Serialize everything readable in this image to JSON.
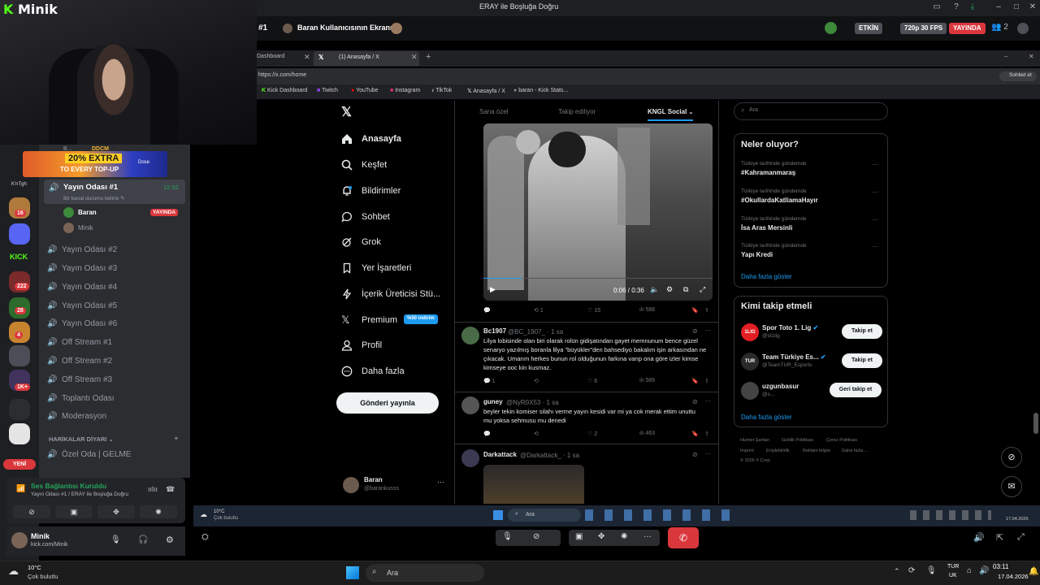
{
  "window": {
    "title": "ERAY ile Boşluğa Doğru"
  },
  "webcam": {
    "brand_k": "K",
    "brand_name": "Minik"
  },
  "promo": {
    "line1": "20% EXTRA",
    "line2": "TO EVERY TOP-UP",
    "logo": "Dose"
  },
  "server_badges": [
    "16",
    "222",
    "28",
    "4",
    "1K+"
  ],
  "server_labels": {
    "kick": "KICK",
    "new": "YENİ",
    "kntg": "K'nTgh"
  },
  "channels": {
    "top_user": "B... ",
    "top_tag": "DDCM",
    "active": {
      "name": "Yayın Odası #1",
      "time": "12:32",
      "status": "Bir kanal durumu belirle"
    },
    "members": [
      {
        "name": "Baran",
        "badge": "YAYINDA"
      },
      {
        "name": "Minik",
        "badge": ""
      }
    ],
    "list": [
      "Yayın Odası #2",
      "Yayın Odası #3",
      "Yayın Odası #4",
      "Yayın Odası #5",
      "Yayın Odası #6",
      "Off Stream #1",
      "Off Stream #2",
      "Off Stream #3",
      "Toplantı Odası",
      "Moderasyon"
    ],
    "category": "HARİKALAR DİYARI",
    "category_item": "Özel Oda | GELME"
  },
  "voice": {
    "status": "Ses Bağlantısı Kuruldu",
    "location": "Yayın Odası #1 / ERAY ile Boşluğa Doğru"
  },
  "user": {
    "name": "Minik",
    "sub": "kick.com/Minik"
  },
  "stream": {
    "channel": "#1",
    "screen_title": "Baran Kullanıcısının Ekranı",
    "pill_live_label": "ETKİN",
    "pill_quality": "720p 30 FPS",
    "pill_live": "YAYINDA",
    "viewers": "2"
  },
  "browser": {
    "tab1": "Dashboard",
    "tab2": "(1) Anasayfa / X",
    "url": "https://x.com/home",
    "chat_btn": "Sohbet et",
    "bookmarks": [
      "Kick Dashboard",
      "Twitch",
      "YouTube",
      "Instagram",
      "TikTok",
      "Anasayfa / X",
      "baran - Kick Stats..."
    ]
  },
  "x_nav": {
    "items": [
      "Anasayfa",
      "Keşfet",
      "Bildirimler",
      "Sohbet",
      "Grok",
      "Yer İşaretleri",
      "İçerik Üreticisi Stü...",
      "Premium",
      "Profil",
      "Daha fazla"
    ],
    "premium_badge": "%50 indirim",
    "post_button": "Gönderi yayınla",
    "account_name": "Baran",
    "account_handle": "@barankusss"
  },
  "feed": {
    "tabs": [
      "Sana özel",
      "Takip ediliyor",
      "KNGL Social"
    ],
    "video_time": "0:06 / 0:36",
    "video_actions": {
      "replies": "",
      "reposts": "1",
      "likes": "15",
      "views": "588"
    },
    "tweets": [
      {
        "name": "Bc1907",
        "handle": "@BC_1907_ · 1 sa",
        "text": "Lilya lobisinde olan biri olarak rolün gidişatından gayet memnunum bence güzel senaryo yazılmış boranla lilya \"büyükler\"den bahsediyo bakalım işin arkasından ne çıkacak. Umarım herkes bunun rol olduğunun farkına varıp ona göre izler kimse kimseye ooc kin kusmaz.",
        "replies": "1",
        "reposts": "",
        "likes": "6",
        "views": "589"
      },
      {
        "name": "guney",
        "handle": "@NyR0X53 · 1 sa",
        "text": "beyler tekin komiser silahı verme yayın kesidi var mi ya cok merak ettim unuttu mu yoksa sehmusu mu denedi",
        "replies": "",
        "reposts": "",
        "likes": "2",
        "views": "463"
      },
      {
        "name": "Darkattack",
        "handle": "@Darkattack_ · 1 sa",
        "text": ""
      }
    ]
  },
  "search": {
    "placeholder": "Ara"
  },
  "trends": {
    "title": "Neler oluyor?",
    "items": [
      {
        "meta": "Türkiye tarihinde gündemde",
        "name": "#Kahramanmaraş"
      },
      {
        "meta": "Türkiye tarihinde gündemde",
        "name": "#OkullardaKatliamaHayır"
      },
      {
        "meta": "Türkiye tarihinde gündemde",
        "name": "İsa Aras Mersinli"
      },
      {
        "meta": "Türkiye tarihinde gündemde",
        "name": "Yapı Kredi"
      }
    ],
    "more": "Daha fazla göster"
  },
  "follow": {
    "title": "Kimi takip etmeli",
    "items": [
      {
        "name": "Spor Toto 1. Lig",
        "handle": "@st1lig",
        "btn": "Takip et"
      },
      {
        "name": "Team Türkiye Es...",
        "handle": "@TeamTUR_Esports",
        "btn": "Takip et"
      },
      {
        "name": "uzgunbasur",
        "handle": "@s...",
        "btn": "Geri takip et"
      }
    ],
    "more": "Daha fazla göster"
  },
  "x_footer": [
    "Hizmet Şartları",
    "Gizlilik Politikası",
    "Çerez Politikası",
    "Imprint",
    "Erişilebilirlik",
    "Reklam bilgisi",
    "Daha fazla ...",
    "© 2026 X Corp."
  ],
  "inner_taskbar": {
    "weather_temp": "10°C",
    "weather_text": "Çok bulutlu",
    "search": "Ara",
    "date": "17.04.2026"
  },
  "taskbar": {
    "weather_temp": "10°C",
    "weather_text": "Çok bulutlu",
    "search": "Ara",
    "lang1": "TUR",
    "lang2": "UK",
    "time": "03:11",
    "date": "17.04.2026"
  }
}
